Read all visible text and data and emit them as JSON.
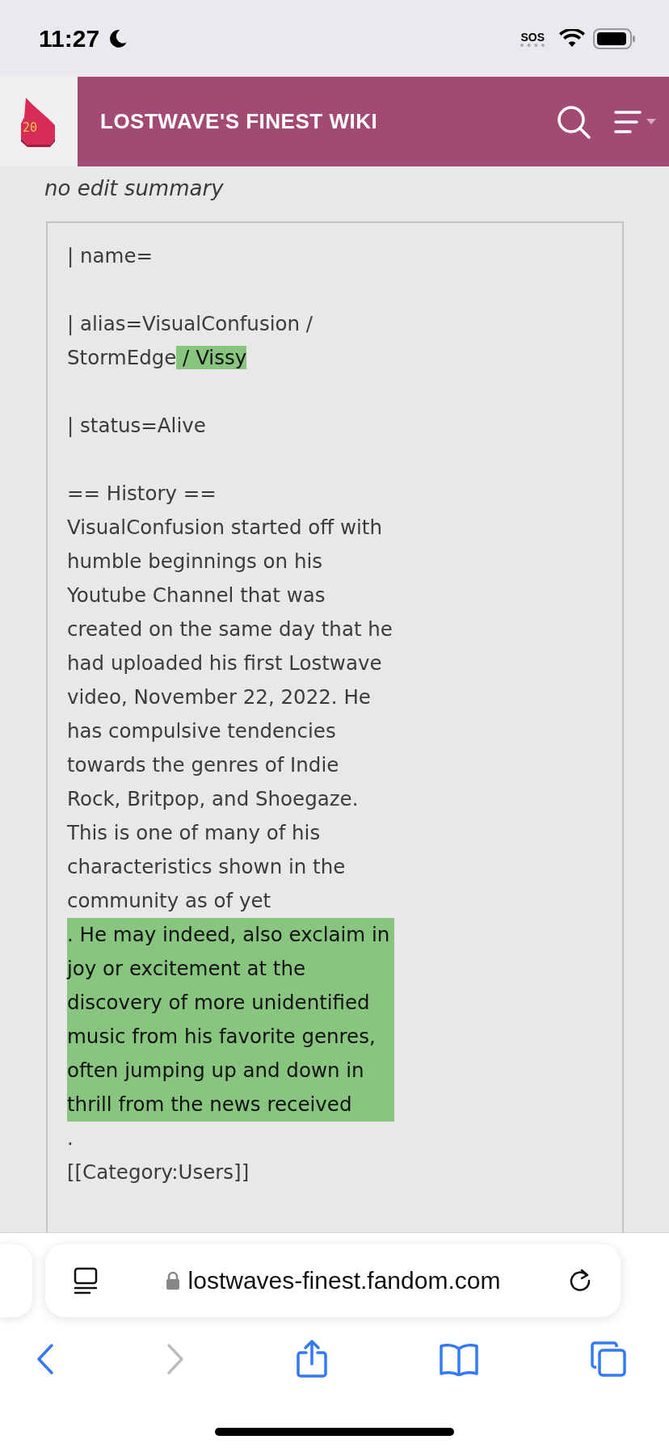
{
  "status_bar": {
    "time": "11:27",
    "sos": "SOS"
  },
  "header": {
    "logo_text": "20",
    "title": "LOSTWAVE'S FINEST WIKI"
  },
  "summary": "no edit summary",
  "diff_blocks": [
    {
      "lines": [
        {
          "segments": [
            {
              "text": "| name=",
              "added": false
            }
          ]
        }
      ]
    },
    {
      "lines": [
        {
          "segments": [
            {
              "text": "| alias=VisualConfusion /",
              "added": false
            }
          ]
        },
        {
          "segments": [
            {
              "text": "StormEdge",
              "added": false
            },
            {
              "text": " / Vissy",
              "added": true
            }
          ]
        }
      ]
    },
    {
      "lines": [
        {
          "segments": [
            {
              "text": "| status=Alive",
              "added": false
            }
          ]
        }
      ]
    },
    {
      "lines": [
        {
          "segments": [
            {
              "text": "== History ==",
              "added": false
            }
          ]
        },
        {
          "segments": [
            {
              "text": "VisualConfusion started off with humble beginnings on his Youtube Channel that was created on the same day that he had uploaded his first Lostwave video, November 22, 2022. He has compulsive tendencies towards the genres of Indie Rock, Britpop, and Shoegaze. This is one of many of his characteristics shown in the community as of yet",
              "added": false
            }
          ]
        },
        {
          "segments": [
            {
              "text": ". He may indeed, also exclaim in joy or excitement at the discovery of more unidentified music from his favorite genres, often jumping up and down in thrill from the news received",
              "added": true
            }
          ]
        },
        {
          "segments": [
            {
              "text": ".",
              "added": false
            }
          ]
        },
        {
          "segments": [
            {
              "text": "[[Category:Users]]",
              "added": false
            }
          ]
        }
      ]
    }
  ],
  "browser": {
    "url": "lostwaves-finest.fandom.com"
  }
}
